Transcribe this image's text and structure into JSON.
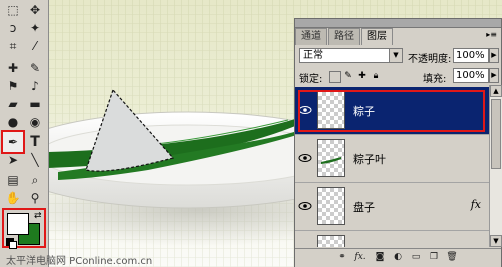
{
  "toolbox": {
    "tools": [
      {
        "name": "marquee-tool-icon",
        "glyph": "⬚"
      },
      {
        "name": "move-tool-icon",
        "glyph": "✥"
      },
      {
        "name": "lasso-tool-icon",
        "glyph": "ↄ"
      },
      {
        "name": "magic-wand-tool-icon",
        "glyph": "✦"
      },
      {
        "name": "crop-tool-icon",
        "glyph": "⌗"
      },
      {
        "name": "slice-tool-icon",
        "glyph": "⁄"
      },
      {
        "name": "healing-brush-tool-icon",
        "glyph": "✚"
      },
      {
        "name": "brush-tool-icon",
        "glyph": "✎"
      },
      {
        "name": "stamp-tool-icon",
        "glyph": "⚑"
      },
      {
        "name": "history-brush-tool-icon",
        "glyph": "♪"
      },
      {
        "name": "eraser-tool-icon",
        "glyph": "▰"
      },
      {
        "name": "gradient-tool-icon",
        "glyph": "▬"
      },
      {
        "name": "blur-tool-icon",
        "glyph": "●"
      },
      {
        "name": "dodge-tool-icon",
        "glyph": "◉"
      },
      {
        "name": "pen-tool-icon",
        "glyph": "✒"
      },
      {
        "name": "type-tool-icon",
        "glyph": "T"
      },
      {
        "name": "path-selection-tool-icon",
        "glyph": "➤"
      },
      {
        "name": "line-tool-icon",
        "glyph": "╲"
      },
      {
        "name": "notes-tool-icon",
        "glyph": "▤"
      },
      {
        "name": "eyedropper-tool-icon",
        "glyph": "⌕"
      },
      {
        "name": "hand-tool-icon",
        "glyph": "✋"
      },
      {
        "name": "zoom-tool-icon",
        "glyph": "⚲"
      }
    ],
    "foreground_color": "#ffffff",
    "background_color": "#1e7a1e",
    "highlight_color": "#e01818"
  },
  "layers_panel": {
    "tabs": [
      "通道",
      "路径",
      "图层"
    ],
    "active_tab": "图层",
    "blend_mode": "正常",
    "opacity_label": "不透明度:",
    "opacity_value": "100%",
    "lock_label": "锁定:",
    "fill_label": "填充:",
    "fill_value": "100%",
    "layers": [
      {
        "name": "粽子",
        "selected": true,
        "fx": ""
      },
      {
        "name": "粽子叶",
        "selected": false,
        "fx": ""
      },
      {
        "name": "盘子",
        "selected": false,
        "fx": "fx"
      }
    ],
    "selected_color": "#0a2470"
  },
  "watermark": "太平洋电脑网 PConline.com.cn"
}
